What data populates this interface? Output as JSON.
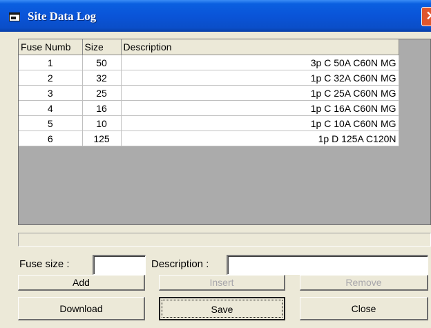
{
  "window": {
    "title": "Site Data Log",
    "close_glyph": "✕"
  },
  "grid": {
    "columns": [
      "Fuse Numb",
      "Size",
      "Description"
    ],
    "rows": [
      [
        "1",
        "50",
        "3p C 50A C60N MG"
      ],
      [
        "2",
        "32",
        "1p C 32A C60N MG"
      ],
      [
        "3",
        "25",
        "1p C 25A C60N MG"
      ],
      [
        "4",
        "16",
        "1p C 16A C60N MG"
      ],
      [
        "5",
        "10",
        "1p C 10A C60N MG"
      ],
      [
        "6",
        "125",
        "1p D 125A C120N"
      ]
    ]
  },
  "form": {
    "fuse_size_label": "Fuse size :",
    "fuse_size_value": "",
    "description_label": "Description :",
    "description_value": ""
  },
  "buttons": {
    "add": "Add",
    "insert": "Insert",
    "remove": "Remove",
    "download": "Download",
    "save": "Save",
    "close": "Close"
  },
  "colors": {
    "titlebar": "#0a54d8",
    "face": "#ece9d8",
    "grid_background": "#ababab",
    "close_button": "#e0562c"
  }
}
